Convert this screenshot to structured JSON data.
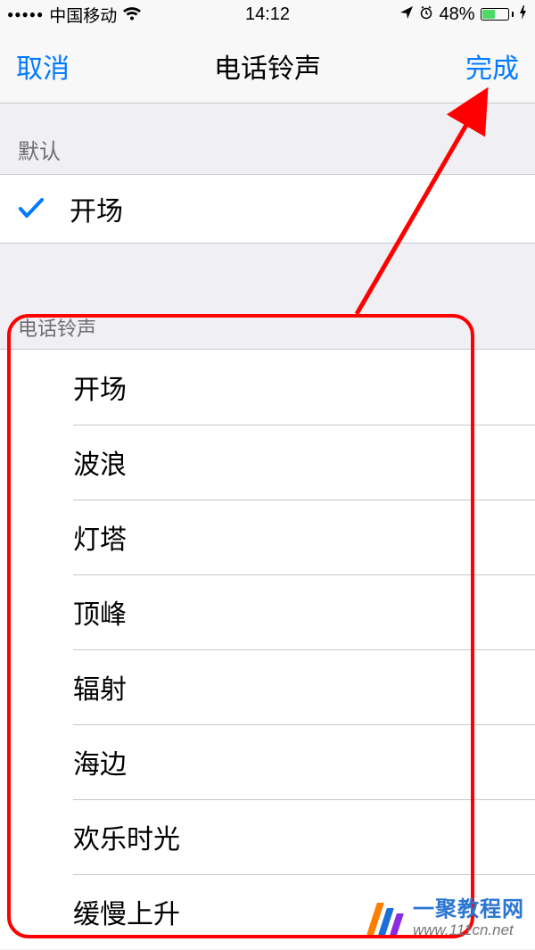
{
  "status": {
    "signal_dots": "●●●●●",
    "carrier": "中国移动",
    "time": "14:12",
    "battery_percent": "48%"
  },
  "nav": {
    "cancel": "取消",
    "title": "电话铃声",
    "done": "完成"
  },
  "sections": {
    "default_header": "默认",
    "default_item": "开场",
    "ringtones_header": "电话铃声",
    "ringtones": [
      "开场",
      "波浪",
      "灯塔",
      "顶峰",
      "辐射",
      "海边",
      "欢乐时光",
      "缓慢上升"
    ]
  },
  "watermark": {
    "cn": "一聚教程网",
    "url": "www.111cn.net"
  }
}
